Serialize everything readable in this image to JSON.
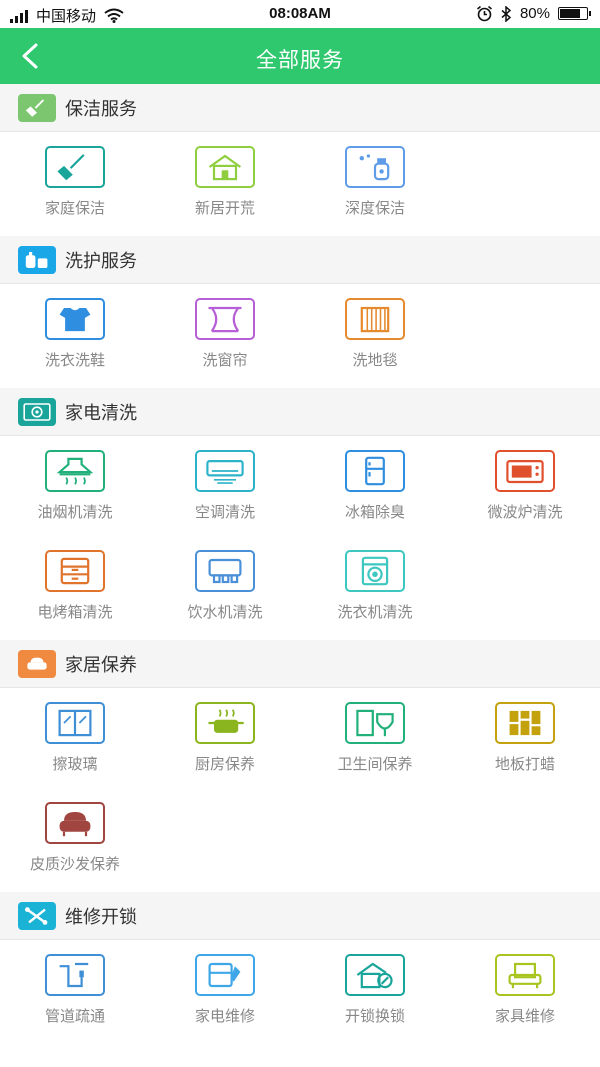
{
  "status_bar": {
    "carrier": "中国移动",
    "time": "08:08AM",
    "battery": "80%",
    "battery_level": 0.8
  },
  "nav": {
    "title": "全部服务"
  },
  "sections": [
    {
      "title": "保洁服务",
      "color": "#7cc66f",
      "icon": "broom-icon",
      "items": [
        {
          "label": "家庭保洁",
          "color": "#1aa59a",
          "icon": "broom-icon"
        },
        {
          "label": "新居开荒",
          "color": "#8fce3f",
          "icon": "house-icon"
        },
        {
          "label": "深度保洁",
          "color": "#5f9ce8",
          "icon": "spray-bottle-icon"
        }
      ]
    },
    {
      "title": "洗护服务",
      "color": "#1aa7e8",
      "icon": "detergent-icon",
      "items": [
        {
          "label": "洗衣洗鞋",
          "color": "#2f8ee0",
          "icon": "shirt-icon"
        },
        {
          "label": "洗窗帘",
          "color": "#b75fd6",
          "icon": "curtain-icon"
        },
        {
          "label": "洗地毯",
          "color": "#e58a2e",
          "icon": "carpet-icon"
        }
      ]
    },
    {
      "title": "家电清洗",
      "color": "#1aa59a",
      "icon": "appliance-icon",
      "items": [
        {
          "label": "油烟机清洗",
          "color": "#22b07a",
          "icon": "range-hood-icon"
        },
        {
          "label": "空调清洗",
          "color": "#2cb3c9",
          "icon": "air-conditioner-icon"
        },
        {
          "label": "冰箱除臭",
          "color": "#2f8ee0",
          "icon": "fridge-icon"
        },
        {
          "label": "微波炉清洗",
          "color": "#e0502d",
          "icon": "microwave-icon"
        },
        {
          "label": "电烤箱清洗",
          "color": "#e0742d",
          "icon": "oven-icon"
        },
        {
          "label": "饮水机清洗",
          "color": "#4a90d9",
          "icon": "water-dispenser-icon"
        },
        {
          "label": "洗衣机清洗",
          "color": "#3cc7c0",
          "icon": "washing-machine-icon"
        }
      ]
    },
    {
      "title": "家居保养",
      "color": "#f08a40",
      "icon": "sofa-icon",
      "items": [
        {
          "label": "擦玻璃",
          "color": "#3f8fd6",
          "icon": "window-icon"
        },
        {
          "label": "厨房保养",
          "color": "#8bb51f",
          "icon": "pot-icon"
        },
        {
          "label": "卫生间保养",
          "color": "#22b07a",
          "icon": "bathroom-icon"
        },
        {
          "label": "地板打蜡",
          "color": "#c3a20e",
          "icon": "floor-icon"
        },
        {
          "label": "皮质沙发保养",
          "color": "#a0453f",
          "icon": "armchair-icon"
        }
      ]
    },
    {
      "title": "维修开锁",
      "color": "#1ab3d6",
      "icon": "tools-icon",
      "items": [
        {
          "label": "管道疏通",
          "color": "#3f8fd6",
          "icon": "pipe-icon"
        },
        {
          "label": "家电维修",
          "color": "#3fa7e8",
          "icon": "appliance-repair-icon"
        },
        {
          "label": "开锁换锁",
          "color": "#1aa59a",
          "icon": "house-key-icon"
        },
        {
          "label": "家具维修",
          "color": "#a7c51e",
          "icon": "furniture-icon"
        }
      ]
    }
  ]
}
